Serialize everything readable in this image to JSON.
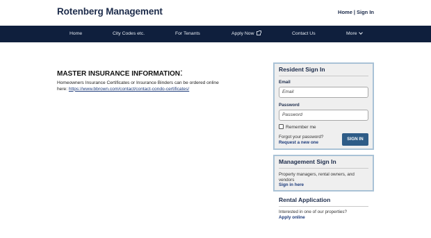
{
  "header": {
    "site_title": "Rotenberg Management",
    "top_links": [
      "Home",
      "Sign In"
    ],
    "separator": "|"
  },
  "nav": {
    "items": [
      {
        "label": "Home"
      },
      {
        "label": "City Codes etc."
      },
      {
        "label": "For Tenants"
      },
      {
        "label": "Apply Now",
        "icon": "external-link-icon"
      },
      {
        "label": "Contact Us"
      },
      {
        "label": "More",
        "icon": "chevron-down-icon"
      }
    ],
    "background": "#0f1f3d"
  },
  "main": {
    "heading": "MASTER INSURANCE INFORMATION",
    "heading_colon": ":",
    "body_text": "Homeowners Insurance Certificates or Insurance Binders can be ordered online here: ",
    "link_text": "https://www.bbrown.com/contact/contact-condo-certificates/"
  },
  "resident_signin": {
    "title": "Resident Sign In",
    "email_label": "Email",
    "email_placeholder": "Email",
    "password_label": "Password",
    "password_placeholder": "Password",
    "remember_label": "Remember me",
    "forgot_text": "Forgot your password?",
    "reset_link": "Request a new one",
    "button_label": "SIGN IN",
    "button_color": "#2e5c87"
  },
  "management_signin": {
    "title": "Management Sign In",
    "description": "Property managers, rental owners, and vendors",
    "link": "Sign in here"
  },
  "rental_application": {
    "title": "Rental Application",
    "description": "Interested in one of our properties?",
    "link": "Apply online"
  }
}
